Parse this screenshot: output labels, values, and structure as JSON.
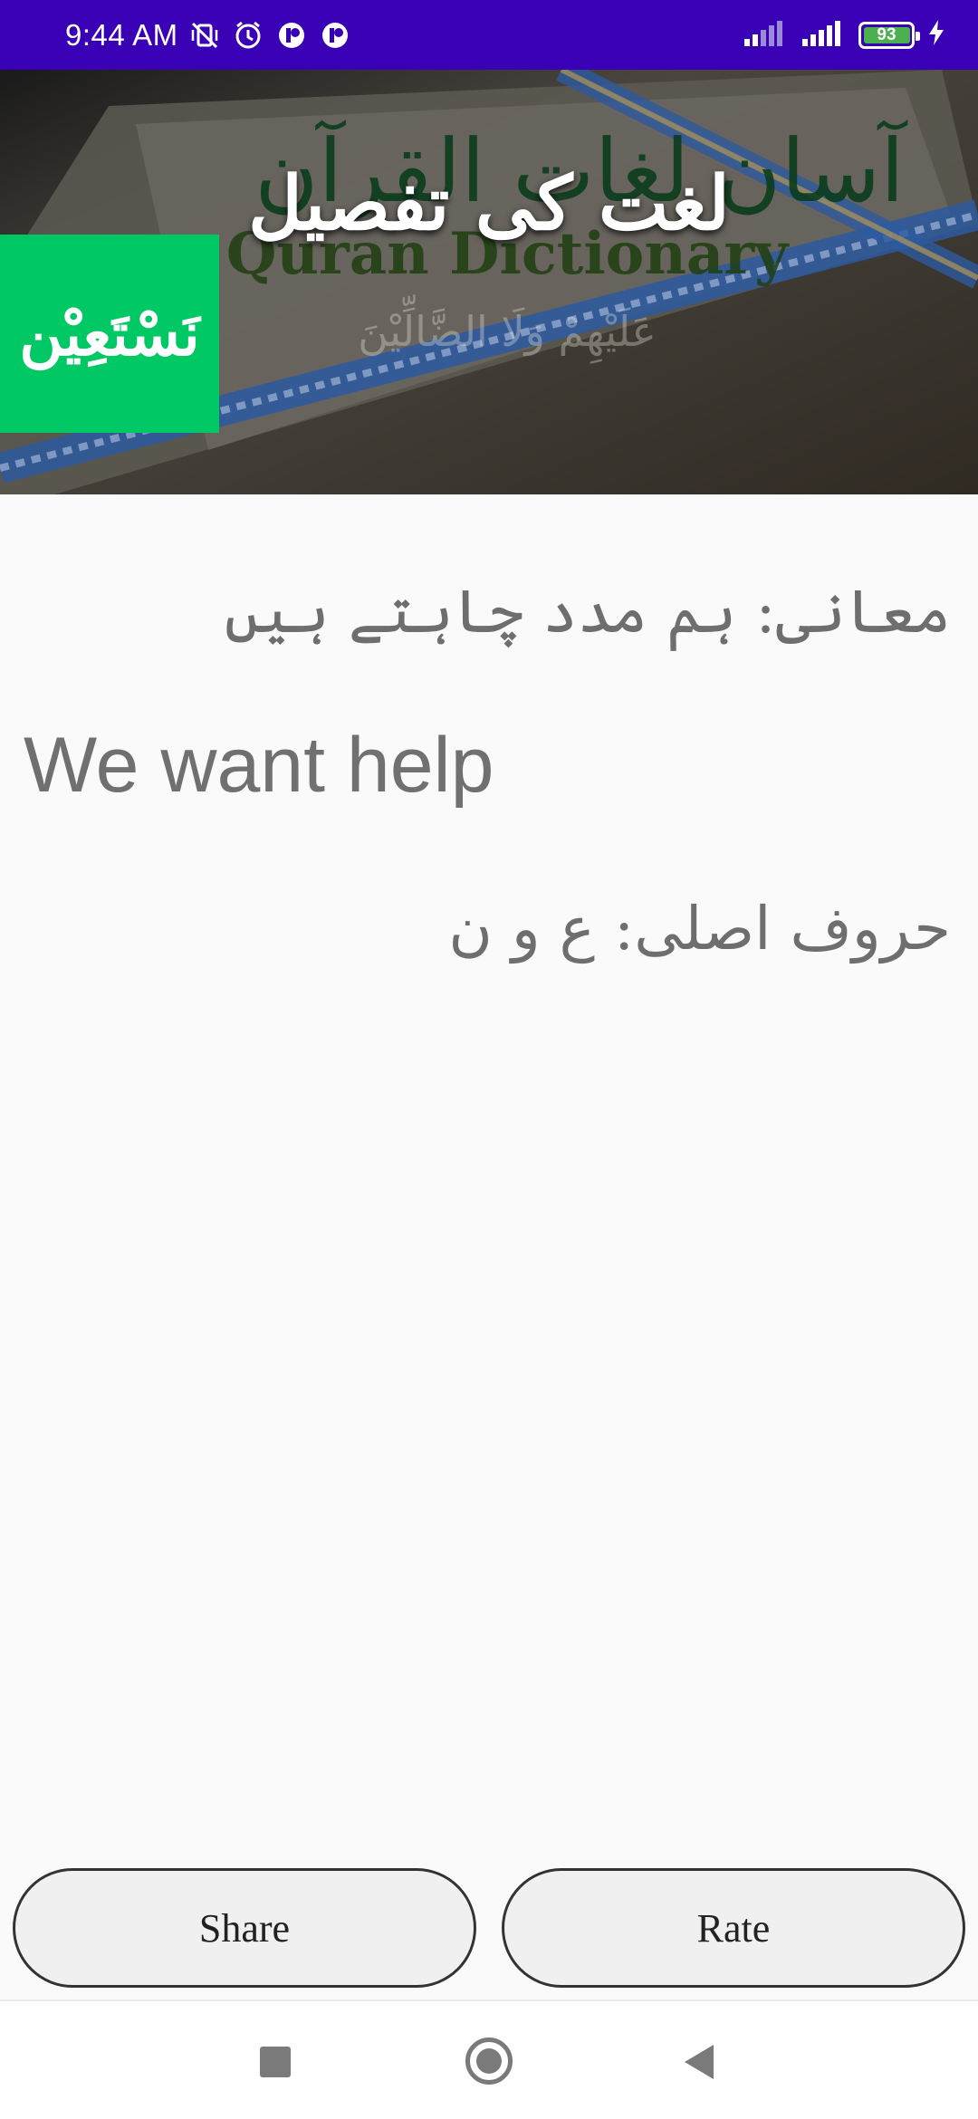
{
  "status_bar": {
    "time": "9:44 AM",
    "left_icons": [
      "vibrate-off-icon",
      "alarm-icon",
      "app-notification-icon",
      "app-notification-icon"
    ],
    "right_icons": [
      "signal-icon",
      "signal-icon",
      "battery-icon",
      "charging-icon"
    ],
    "battery_level": "93",
    "battery_color": "#4caf50"
  },
  "header": {
    "title": "لغت کی تفصیل",
    "word": "نَسْتَعِيْن",
    "badge_color": "#00c864"
  },
  "content": {
    "meaning_urdu": "معانی: ہم مدد چاہتے ہیں",
    "meaning_english": "We want help",
    "root_letters": "حروف اصلی: ع و ن"
  },
  "actions": {
    "share_label": "Share",
    "rate_label": "Rate"
  },
  "nav": {
    "icons": [
      "recents-icon",
      "home-icon",
      "back-icon"
    ]
  },
  "colors": {
    "status_bar": "#3a00b5",
    "text_gray": "#707070"
  }
}
